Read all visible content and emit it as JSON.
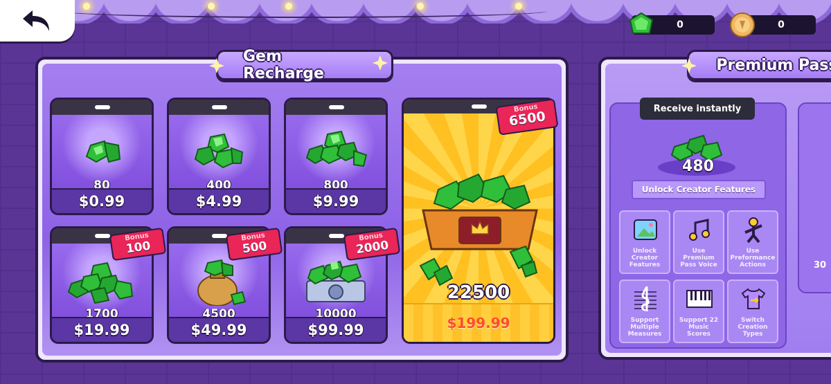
{
  "header": {
    "back_button": "back-arrow-icon",
    "currencies": [
      {
        "icon": "green-gem-icon",
        "value": "0"
      },
      {
        "icon": "gold-coin-icon",
        "value": "0"
      }
    ]
  },
  "gem_recharge": {
    "title": "Gem Recharge",
    "packs": [
      {
        "amount": "80",
        "price": "$0.99",
        "bonus_label": "",
        "bonus_value": ""
      },
      {
        "amount": "400",
        "price": "$4.99",
        "bonus_label": "",
        "bonus_value": ""
      },
      {
        "amount": "800",
        "price": "$9.99",
        "bonus_label": "",
        "bonus_value": ""
      },
      {
        "amount": "1700",
        "price": "$19.99",
        "bonus_label": "Bonus",
        "bonus_value": "100"
      },
      {
        "amount": "4500",
        "price": "$49.99",
        "bonus_label": "Bonus",
        "bonus_value": "500"
      },
      {
        "amount": "10000",
        "price": "$99.99",
        "bonus_label": "Bonus",
        "bonus_value": "2000"
      }
    ],
    "featured": {
      "amount": "22500",
      "price": "$199.99",
      "bonus_label": "Bonus",
      "bonus_value": "6500"
    }
  },
  "premium_pass": {
    "title": "Premium Pass",
    "receive_label": "Receive instantly",
    "gem_amount": "480",
    "unlock_label": "Unlock Creator Features",
    "features": [
      {
        "icon": "image-icon",
        "label": "Unlock Creator Features"
      },
      {
        "icon": "music-note-icon",
        "label": "Use Premium Pass Voice"
      },
      {
        "icon": "performer-icon",
        "label": "Use Preformance Actions"
      },
      {
        "icon": "treble-clef-icon",
        "label": "Support Multiple Measures"
      },
      {
        "icon": "piano-keys-icon",
        "label": "Support 22 Music Scores"
      },
      {
        "icon": "shirt-switch-icon",
        "label": "Switch Creation Types"
      }
    ],
    "next_card_value": "30"
  },
  "colors": {
    "accent_purple": "#8e62e6",
    "bonus_red": "#ea2557",
    "gold": "#ffc022",
    "gem_green": "#2fbf3a"
  }
}
